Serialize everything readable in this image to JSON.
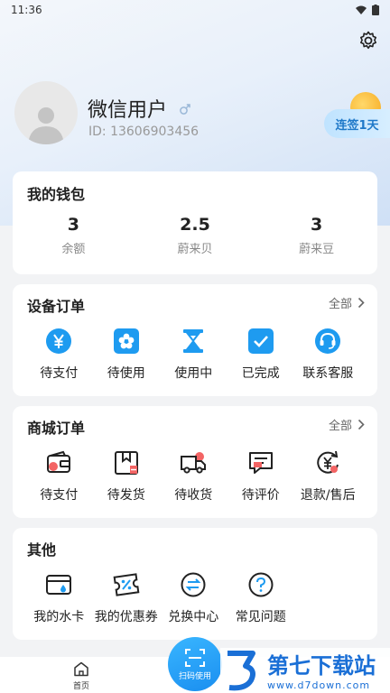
{
  "status_bar": {
    "time": "11:36"
  },
  "profile": {
    "name": "微信用户",
    "id": "ID: 13606903456",
    "streak_badge": "连签1天"
  },
  "wallet": {
    "title": "我的钱包",
    "stats": [
      {
        "value": "3",
        "label": "余额"
      },
      {
        "value": "2.5",
        "label": "蔚来贝"
      },
      {
        "value": "3",
        "label": "蔚来豆"
      }
    ]
  },
  "device_orders": {
    "title": "设备订单",
    "link": "全部",
    "items": [
      {
        "label": "待支付",
        "icon": "yen-icon"
      },
      {
        "label": "待使用",
        "icon": "flower-icon"
      },
      {
        "label": "使用中",
        "icon": "hourglass-icon"
      },
      {
        "label": "已完成",
        "icon": "check-icon"
      },
      {
        "label": "联系客服",
        "icon": "headset-icon"
      }
    ]
  },
  "shop_orders": {
    "title": "商城订单",
    "link": "全部",
    "items": [
      {
        "label": "待支付",
        "icon": "wallet-icon"
      },
      {
        "label": "待发货",
        "icon": "box-icon"
      },
      {
        "label": "待收货",
        "icon": "truck-icon"
      },
      {
        "label": "待评价",
        "icon": "comment-icon"
      },
      {
        "label": "退款/售后",
        "icon": "refund-icon"
      }
    ]
  },
  "other": {
    "title": "其他",
    "items": [
      {
        "label": "我的水卡",
        "icon": "water-card-icon"
      },
      {
        "label": "我的优惠券",
        "icon": "coupon-icon"
      },
      {
        "label": "兑换中心",
        "icon": "exchange-icon"
      },
      {
        "label": "常见问题",
        "icon": "question-icon"
      }
    ]
  },
  "tab_bar": {
    "home": "首页",
    "scan": "扫码使用"
  },
  "watermark": {
    "title": "第七下载站",
    "url": "www.d7down.com"
  },
  "colors": {
    "accent": "#1e9bf0",
    "red": "#f36464"
  }
}
